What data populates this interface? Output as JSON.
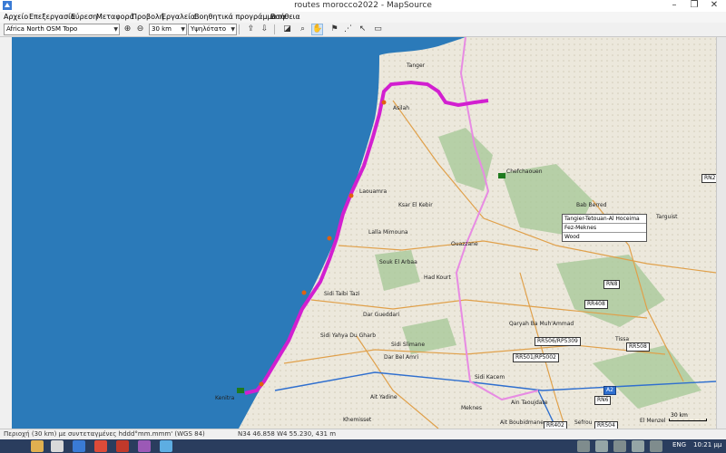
{
  "window": {
    "title": "routes morocco2022 - MapSource",
    "min": "–",
    "max": "❐",
    "close": "✕"
  },
  "menu": [
    "Αρχείο",
    "Επεξεργασία",
    "Εύρεση",
    "Μεταφορά",
    "Προβολή",
    "Εργαλεία",
    "Βοηθητικά προγράμματα",
    "Βοήθεια"
  ],
  "toolbar": {
    "map_product": "Africa North OSM Topo",
    "scale": "30 km",
    "detail": "Υψηλότατο",
    "icons": {
      "zoom_in": "zoom-in-icon",
      "zoom_out": "zoom-out-icon",
      "send_to_device": "send-to-device-icon",
      "receive_from_device": "receive-from-device-icon",
      "zoom_tool": "magnifier-icon",
      "pan_tool": "hand-icon",
      "waypoint_tool": "flag-icon",
      "route_tool": "route-icon",
      "select_tool": "arrow-pointer-icon",
      "measure_tool": "ruler-icon"
    }
  },
  "map": {
    "places": [
      {
        "name": "Tanger",
        "key": "tanger"
      },
      {
        "name": "Asilah",
        "key": "asilah"
      },
      {
        "name": "Laouamra",
        "key": "laouamra"
      },
      {
        "name": "Ksar El Kebir",
        "key": "ksar"
      },
      {
        "name": "Lalla Mimouna",
        "key": "lalla"
      },
      {
        "name": "Souk El Arbaa",
        "key": "souk"
      },
      {
        "name": "Had Kourt",
        "key": "hadkourt"
      },
      {
        "name": "Sidi Taibi Tazi",
        "key": "tazi"
      },
      {
        "name": "Dar Gueddari",
        "key": "dargueddari"
      },
      {
        "name": "Sidi Yahya Du Gharb",
        "key": "yahya"
      },
      {
        "name": "Sidi Slimane",
        "key": "slimane"
      },
      {
        "name": "Dar Bel Amri",
        "key": "belamri"
      },
      {
        "name": "Sidi Kacem",
        "key": "kacem"
      },
      {
        "name": "Ouazzane",
        "key": "ouazzane"
      },
      {
        "name": "Chefchaouen",
        "key": "chefchaouen"
      },
      {
        "name": "Bab Berred",
        "key": "babberred"
      },
      {
        "name": "Targuist",
        "key": "targuist"
      },
      {
        "name": "Tissa",
        "key": "tissa"
      },
      {
        "name": "Qaryah Ba Muh'Ammad",
        "key": "qaryah"
      },
      {
        "name": "Ain Taoujdate",
        "key": "aintaoujdate"
      },
      {
        "name": "Ait Yadine",
        "key": "aityadine"
      },
      {
        "name": "Khemisset",
        "key": "khemisset"
      },
      {
        "name": "Ait Boubidmane",
        "key": "boubidmane"
      },
      {
        "name": "Sefrou",
        "key": "sefrou"
      },
      {
        "name": "Kenitra",
        "key": "kenitra"
      },
      {
        "name": "Meknes",
        "key": "meknes"
      },
      {
        "name": "El Menzel",
        "key": "menzel"
      }
    ],
    "road_labels": {
      "rn2": "RN2",
      "rn8": "RN8",
      "rr408": "RR408",
      "rr506": "RR506/RP5309",
      "rr508": "RR508",
      "rr501": "RR501/RP5002",
      "a2": "A2",
      "rn6": "RN6",
      "rr402": "RR402",
      "rr504": "RR504"
    },
    "legend": [
      "Tangier-Tetouan-Al Hoceima",
      "Fez-Meknes",
      "Wood"
    ],
    "scale_label": "30 km",
    "colors": {
      "water": "#2b7ab9",
      "route": "#d21fd0",
      "road_secondary": "#e0a04a"
    }
  },
  "statusbar": {
    "left": "Περιοχή (30 km) με συντεταγμένες hddd°mm.mmm' (WGS 84)",
    "coords": "N34 46.858 W4 55.230, 431 m"
  },
  "taskbar": {
    "lang": "ENG",
    "time": "10:21 μμ"
  }
}
